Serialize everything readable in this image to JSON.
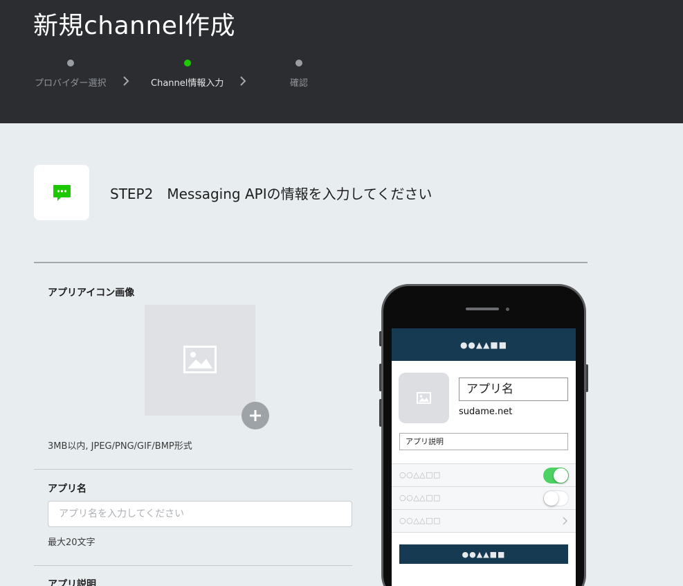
{
  "header": {
    "title": "新規channel作成",
    "steps": [
      {
        "label": "プロバイダー選択",
        "active": false
      },
      {
        "label": "Channel情報入力",
        "active": true
      },
      {
        "label": "確認",
        "active": false
      }
    ]
  },
  "step_section": {
    "heading": "STEP2　Messaging APIの情報を入力してください",
    "icon": "speech-bubble-icon"
  },
  "form": {
    "app_icon": {
      "label": "アプリアイコン画像",
      "hint": "3MB以内, JPEG/PNG/GIF/BMP形式"
    },
    "app_name": {
      "label": "アプリ名",
      "placeholder": "アプリ名を入力してください",
      "hint": "最大20文字"
    },
    "app_description": {
      "label": "アプリ説明"
    }
  },
  "preview": {
    "header_shapes": "●●▲▲■■",
    "app_name": "アプリ名",
    "domain": "sudame.net",
    "description": "アプリ説明",
    "rows": [
      {
        "label": "○○△△□□",
        "control": "toggle-on"
      },
      {
        "label": "○○△△□□",
        "control": "toggle-off"
      },
      {
        "label": "○○△△□□",
        "control": "chevron"
      }
    ],
    "button_shapes": "●●▲▲■■"
  },
  "colors": {
    "header_bg": "#2b2d31",
    "page_bg": "#e8edf0",
    "accent_green": "#1ec800",
    "preview_navy": "#163a52",
    "toggle_green": "#4cd263"
  }
}
